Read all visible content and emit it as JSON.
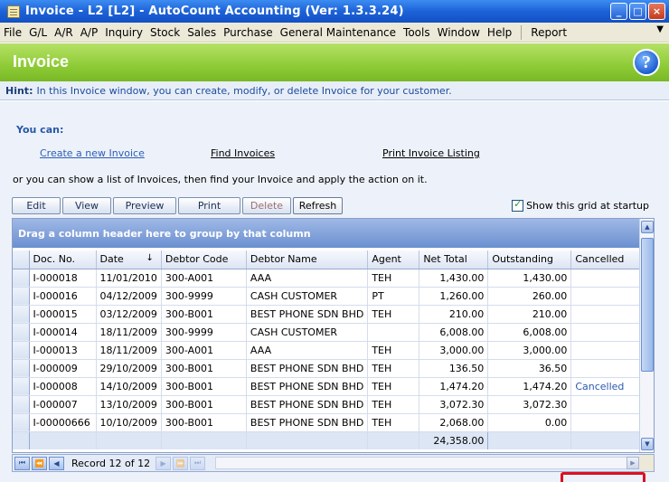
{
  "window": {
    "title": "Invoice - L2 [L2] - AutoCount Accounting (Ver: 1.3.3.24)",
    "min_btn": "_",
    "max_btn": "□",
    "close_btn": "×"
  },
  "menu": {
    "items": [
      "File",
      "G/L",
      "A/R",
      "A/P",
      "Inquiry",
      "Stock",
      "Sales",
      "Purchase",
      "General Maintenance",
      "Tools",
      "Window",
      "Help"
    ],
    "report": "Report",
    "more": "▼"
  },
  "banner": {
    "title": "Invoice",
    "help_glyph": "?"
  },
  "hint": {
    "label": "Hint:",
    "text": "In this Invoice window, you can create, modify, or delete Invoice for your customer."
  },
  "actions": {
    "you_can": "You can:",
    "create_link": "Create a new Invoice",
    "find_link": "Find Invoices",
    "print_listing_link": "Print Invoice Listing",
    "or_text": "or you can show a list of Invoices, then find your Invoice and apply the action on it."
  },
  "toolbar": {
    "edit": "Edit",
    "view": "View",
    "preview": "Preview",
    "print": "Print",
    "delete": "Delete",
    "refresh": "Refresh",
    "show_grid_label": "Show this grid at startup",
    "show_grid_checked": true
  },
  "grid": {
    "group_panel_text": "Drag a column header here to group by that column",
    "columns": [
      "Doc. No.",
      "Date",
      "Debtor Code",
      "Debtor Name",
      "Agent",
      "Net Total",
      "Outstanding",
      "Cancelled"
    ],
    "sort_indicator": "↓",
    "rows": [
      [
        "I-000018",
        "11/01/2010",
        "300-A001",
        "AAA",
        "TEH",
        "1,430.00",
        "1,430.00",
        ""
      ],
      [
        "I-000016",
        "04/12/2009",
        "300-9999",
        "CASH CUSTOMER",
        "PT",
        "1,260.00",
        "260.00",
        ""
      ],
      [
        "I-000015",
        "03/12/2009",
        "300-B001",
        "BEST PHONE SDN BHD",
        "TEH",
        "210.00",
        "210.00",
        ""
      ],
      [
        "I-000014",
        "18/11/2009",
        "300-9999",
        "CASH CUSTOMER",
        "",
        "6,008.00",
        "6,008.00",
        ""
      ],
      [
        "I-000013",
        "18/11/2009",
        "300-A001",
        "AAA",
        "TEH",
        "3,000.00",
        "3,000.00",
        ""
      ],
      [
        "I-000009",
        "29/10/2009",
        "300-B001",
        "BEST PHONE SDN BHD",
        "TEH",
        "136.50",
        "36.50",
        ""
      ],
      [
        "I-000008",
        "14/10/2009",
        "300-B001",
        "BEST PHONE SDN BHD",
        "TEH",
        "1,474.20",
        "1,474.20",
        "Cancelled"
      ],
      [
        "I-000007",
        "13/10/2009",
        "300-B001",
        "BEST PHONE SDN BHD",
        "TEH",
        "3,072.30",
        "3,072.30",
        ""
      ],
      [
        "I-00000666",
        "10/10/2009",
        "300-B001",
        "BEST PHONE SDN BHD",
        "TEH",
        "2,068.00",
        "0.00",
        ""
      ]
    ],
    "net_total_sum": "24,358.00"
  },
  "navigator": {
    "record_text": "Record 12 of 12",
    "first": "⏮",
    "prev_page": "⏪",
    "prev": "◀",
    "next": "▶",
    "next_page": "⏩",
    "last": "⏭"
  },
  "colors": {
    "banner_green": "#8ecb36",
    "titlebar_blue": "#1d62d8",
    "highlight_red": "#dd1020",
    "link_blue": "#2d5eb5"
  }
}
